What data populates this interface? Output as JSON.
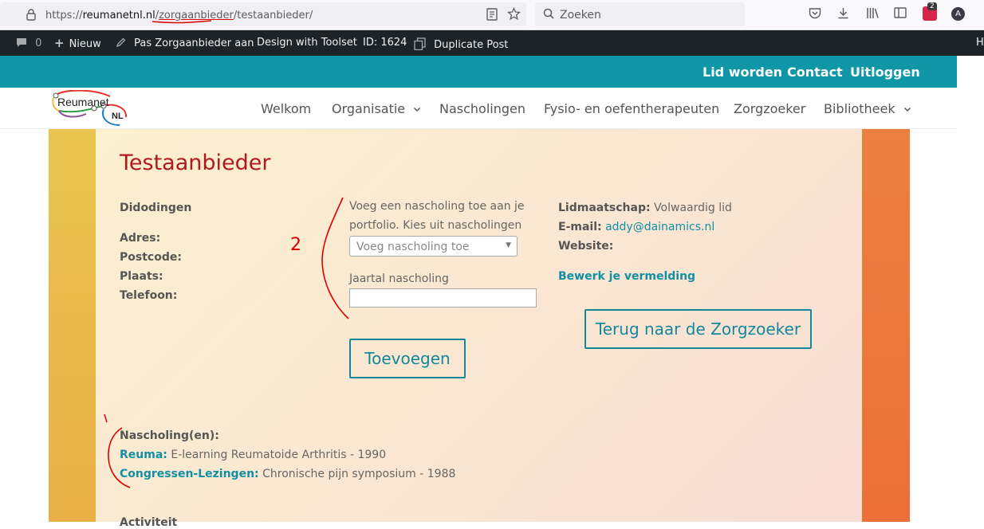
{
  "browser": {
    "url_prefix": "https://",
    "url_domain": "reumanetnl.nl",
    "url_slash": "/",
    "url_seg1": "zorgaanbieder",
    "url_rest": "/testaanbieder/",
    "search_placeholder": "Zoeken",
    "extension_badge": "2",
    "avatar_letter": "A"
  },
  "admin_bar": {
    "comments_count": "0",
    "new_label": "Nieuw",
    "edit_label": "Pas Zorgaanbieder aan",
    "toolset_label": "Design with Toolset",
    "id_label": "ID: 1624",
    "duplicate_label": "Duplicate Post",
    "howdy_fragment": "H"
  },
  "header": {
    "top_links": [
      "Lid worden",
      "Contact",
      "Uitloggen"
    ],
    "logo_text": "Reumanet",
    "logo_sub": "NL",
    "nav": [
      "Welkom",
      "Organisatie",
      "Nascholingen",
      "Fysio- en oefentherapeuten",
      "Zorgzoeker",
      "Bibliotheek"
    ]
  },
  "page": {
    "title": "Testaanbieder",
    "left": {
      "name": "Didodingen",
      "adres": "Adres:",
      "postcode": "Postcode:",
      "plaats": "Plaats:",
      "telefoon": "Telefoon:"
    },
    "middle": {
      "intro_line1": "Voeg een nascholing toe aan je",
      "intro_line2": "portfolio. Kies uit nascholingen",
      "select_placeholder": "Voeg nascholing toe",
      "year_label": "Jaartal nascholing",
      "year_value": "",
      "add_button": "Toevoegen"
    },
    "right": {
      "membership_label": "Lidmaatschap:",
      "membership_value": "Volwaardig lid",
      "email_label": "E-mail:",
      "email_value": "addy@dainamics.nl",
      "website_label": "Website:",
      "edit_link": "Bewerk je vermelding",
      "back_button": "Terug naar de Zorgzoeker"
    },
    "courses": {
      "heading": "Nascholing(en):",
      "items": [
        {
          "category": "Reuma:",
          "text": "E-learning Reumatoide Arthritis - 1990"
        },
        {
          "category": "Congressen-Lezingen:",
          "text": "Chronische pijn symposium - 1988"
        }
      ]
    },
    "next_heading_fragment": "Activiteit"
  },
  "annotations": {
    "number_mark": "2"
  },
  "colors": {
    "teal": "#0f97a8",
    "title_red": "#b3181c",
    "link_teal": "#118fa5",
    "admin_bar": "#1d2327"
  }
}
